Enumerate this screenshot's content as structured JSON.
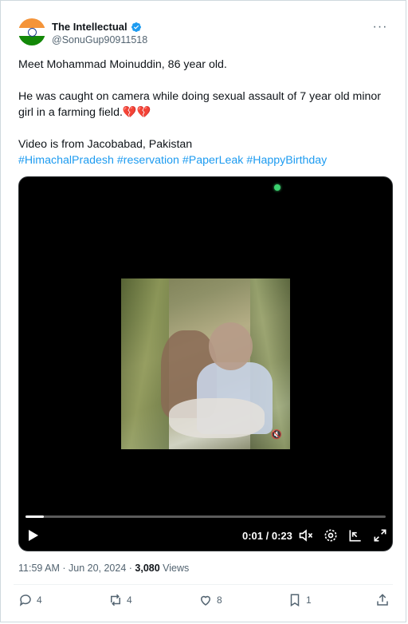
{
  "author": {
    "display_name": "The Intellectual",
    "handle": "@SonuGup90911518",
    "avatar": "india-flag",
    "verified": true
  },
  "tweet": {
    "line1": "Meet Mohammad Moinuddin, 86 year old.",
    "line2": "He was caught on camera while doing sexual assault of 7 year old minor girl in a farming field.",
    "line2_emoji": "💔💔",
    "line3": "Video is from Jacobabad, Pakistan",
    "hashtags": [
      "#HimachalPradesh",
      "#reservation",
      "#PaperLeak",
      "#HappyBirthday"
    ]
  },
  "video": {
    "current_time": "0:01",
    "separator": " / ",
    "duration": "0:23",
    "progress": 0.05,
    "controls": [
      "play-icon",
      "volume-muted-icon",
      "settings-gear-icon",
      "pip-icon",
      "fullscreen-icon"
    ]
  },
  "meta": {
    "time": "11:59 AM",
    "sep": " · ",
    "date": "Jun 20, 2024",
    "sep2": " · ",
    "views_count": "3,080",
    "views_label": " Views"
  },
  "actions": {
    "replies": "4",
    "reposts": "4",
    "likes": "8",
    "bookmarks": "1"
  },
  "colors": {
    "accent": "#1d9bf0",
    "text": "#0f1419",
    "secondary": "#536471"
  }
}
